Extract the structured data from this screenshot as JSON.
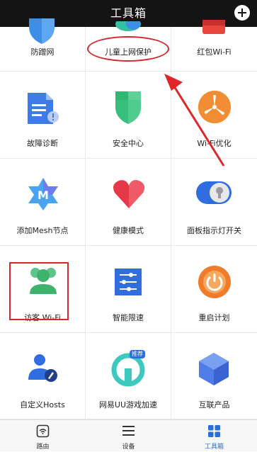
{
  "header": {
    "title": "工具箱",
    "add_icon": "plus-icon"
  },
  "tools": [
    {
      "label": "防蹭网",
      "icon": "shield-icon"
    },
    {
      "label": "儿童上网保护",
      "icon": "child-protect-icon"
    },
    {
      "label": "红包Wi-Fi",
      "icon": "red-packet-icon"
    },
    {
      "label": "故障诊断",
      "icon": "diagnose-doc-icon"
    },
    {
      "label": "安全中心",
      "icon": "security-shield-icon"
    },
    {
      "label": "Wi-Fi优化",
      "icon": "fan-icon"
    },
    {
      "label": "添加Mesh节点",
      "icon": "mesh-star-icon"
    },
    {
      "label": "健康模式",
      "icon": "heart-icon"
    },
    {
      "label": "面板指示灯开关",
      "icon": "toggle-bulb-icon"
    },
    {
      "label": "访客 Wi-Fi",
      "icon": "guests-icon"
    },
    {
      "label": "智能限速",
      "icon": "sliders-icon"
    },
    {
      "label": "重启计划",
      "icon": "power-icon"
    },
    {
      "label": "自定义Hosts",
      "icon": "user-edit-icon"
    },
    {
      "label": "网易UU游戏加速",
      "icon": "uu-accelerate-icon",
      "badge": "推荐"
    },
    {
      "label": "互联产品",
      "icon": "cube-icon"
    }
  ],
  "tabbar": [
    {
      "label": "路由",
      "icon": "router-icon",
      "active": false
    },
    {
      "label": "设备",
      "icon": "menu-icon",
      "active": false
    },
    {
      "label": "工具箱",
      "icon": "grid-icon",
      "active": true
    }
  ],
  "colors": {
    "header_bg": "#141414",
    "annotation_red": "#d4282c",
    "active_tab": "#2b6fd6"
  }
}
